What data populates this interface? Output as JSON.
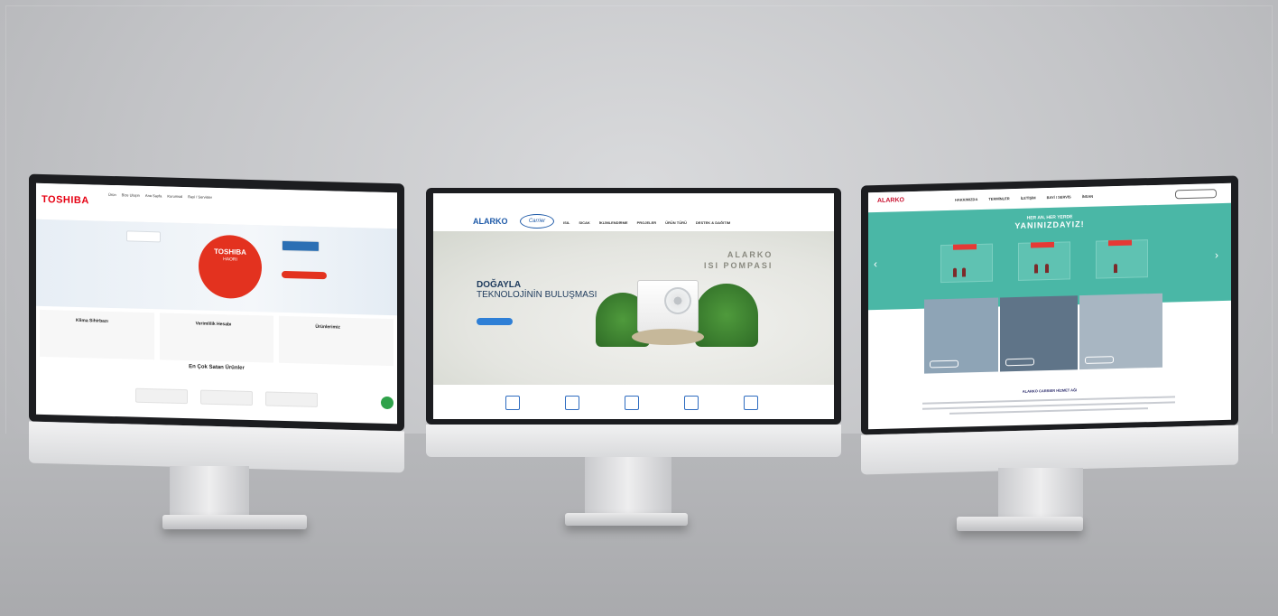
{
  "left_site": {
    "logo": "TOSHIBA",
    "nav": [
      "Ürün",
      "Bize Ulaşın",
      "Ana Sayfa",
      "Kurumsal",
      "Bayi / Servisler"
    ],
    "hero": {
      "circle_title": "TOSHIBA",
      "circle_sub": "HAORI"
    },
    "cards": [
      "Klima Sihirbazı",
      "Verimlilik Hesabı",
      "Ürünlerimiz"
    ],
    "section_title": "En Çok Satan Ürünler"
  },
  "center_site": {
    "logo": "ALARKO",
    "partner_logo": "Carrier",
    "nav": [
      "ISIL",
      "SICAK",
      "İKLİMLENDİRME",
      "PROJELER",
      "ÜRÜN TÜRÜ",
      "DESTEK & DAĞITIM"
    ],
    "hero_title_line1": "DOĞAYLA",
    "hero_title_line2": "TEKNOLOJİNİN BULUŞMASI",
    "hero_right_line1": "ALARKO",
    "hero_right_line2": "ISI POMPASI"
  },
  "right_site": {
    "logo": "ALARKO",
    "nav": [
      "HAKKIMIZDA",
      "TERMİNLER",
      "İLETİŞİM",
      "BAYİ / SERVİS",
      "İNSAN"
    ],
    "hero_title_small": "HER AN, HER YERDE",
    "hero_title_big": "YANINIZDAYIZ!",
    "panel_tags": [
      "HATTIM",
      "SERVİS/BAYİ",
      "İLETİŞİM"
    ],
    "footer_title": "ALARKO CARRIER HİZMET AĞI",
    "colors": {
      "teal": "#4ab7a6",
      "red": "#e53935"
    }
  }
}
